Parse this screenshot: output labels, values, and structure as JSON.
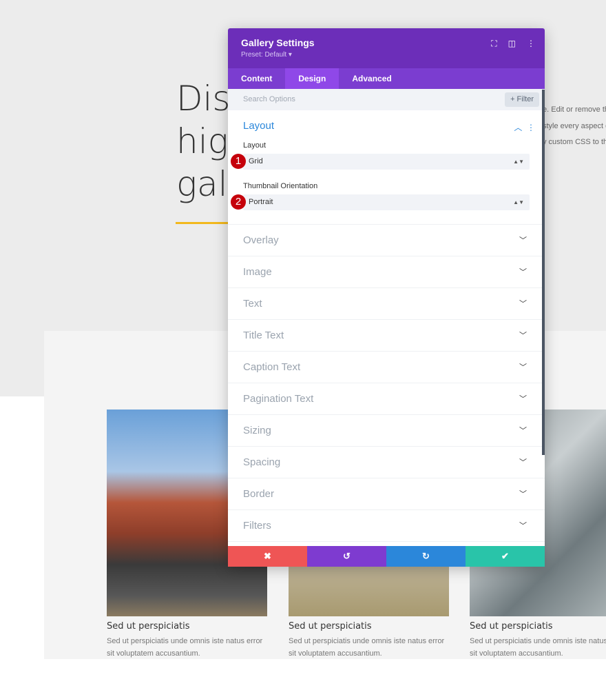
{
  "hero": {
    "line1": "Dis",
    "line2": "hig",
    "line3": "gal"
  },
  "side_text": [
    "e. Edit or remove th",
    "style every aspect o",
    "y custom CSS to thi"
  ],
  "gallery": [
    {
      "title": "Sed ut perspiciatis",
      "desc": "Sed ut perspiciatis unde omnis iste natus error sit voluptatem accusantium."
    },
    {
      "title": "Sed ut perspiciatis",
      "desc": "Sed ut perspiciatis unde omnis iste natus error sit voluptatem accusantium."
    },
    {
      "title": "Sed ut perspiciatis",
      "desc": "Sed ut perspiciatis unde omnis iste natus error sit voluptatem accusantium."
    }
  ],
  "panel": {
    "title": "Gallery Settings",
    "preset": "Preset: Default ▾",
    "tabs": [
      "Content",
      "Design",
      "Advanced"
    ],
    "search_placeholder": "Search Options",
    "filter": "+ Filter",
    "layout": {
      "heading": "Layout",
      "layout_label": "Layout",
      "layout_value": "Grid",
      "orient_label": "Thumbnail Orientation",
      "orient_value": "Portrait",
      "badge1": "1",
      "badge2": "2"
    },
    "sections": [
      "Overlay",
      "Image",
      "Text",
      "Title Text",
      "Caption Text",
      "Pagination Text",
      "Sizing",
      "Spacing",
      "Border",
      "Filters"
    ]
  },
  "footer": {
    "cancel": "✖",
    "undo": "↺",
    "redo": "↻",
    "save": "✔"
  }
}
